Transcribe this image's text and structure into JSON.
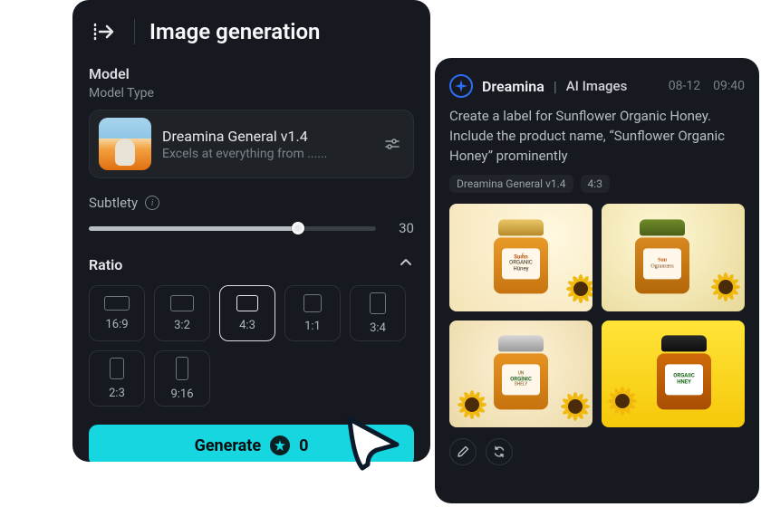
{
  "header": {
    "title": "Image generation"
  },
  "model": {
    "section_title": "Model",
    "type_label": "Model Type",
    "name": "Dreamina General v1.4",
    "desc": "Excels at everything from ......"
  },
  "subtlety": {
    "label": "Subtlety",
    "value": "30"
  },
  "ratio": {
    "title": "Ratio",
    "options": [
      {
        "label": "16:9",
        "shape": "r-16-9",
        "selected": false
      },
      {
        "label": "3:2",
        "shape": "r-3-2",
        "selected": false
      },
      {
        "label": "4:3",
        "shape": "r-4-3",
        "selected": true
      },
      {
        "label": "1:1",
        "shape": "r-1-1",
        "selected": false
      },
      {
        "label": "3:4",
        "shape": "r-3-4",
        "selected": false
      },
      {
        "label": "2:3",
        "shape": "r-2-3",
        "selected": false
      },
      {
        "label": "9:16",
        "shape": "r-9-16",
        "selected": false
      }
    ]
  },
  "generate": {
    "label": "Generate",
    "count": "0"
  },
  "feed": {
    "brand": "Dreamina",
    "subtitle": "AI Images",
    "date": "08-12",
    "time": "09:40",
    "prompt": "Create a label for Sunflower Organic Honey. Include the product name, “Sunflower Organic Honey” prominently",
    "tags": [
      "Dreamina General v1.4",
      "4:3"
    ],
    "thumb_labels": {
      "t1": {
        "line1": "Suıĥn",
        "line2": "ORGANIC",
        "line3": "Hüney"
      },
      "t2": {
        "line1": "Suıı",
        "line2": "Ogranrærs"
      },
      "t3": {
        "line1": "UN",
        "line2": "ORGİNIC",
        "line3": "SHELY"
      },
      "t4": {
        "line1": "ORGAIIC",
        "line2": "HNEY"
      }
    }
  },
  "colors": {
    "accent": "#16d6e0",
    "panel": "#16191f"
  }
}
